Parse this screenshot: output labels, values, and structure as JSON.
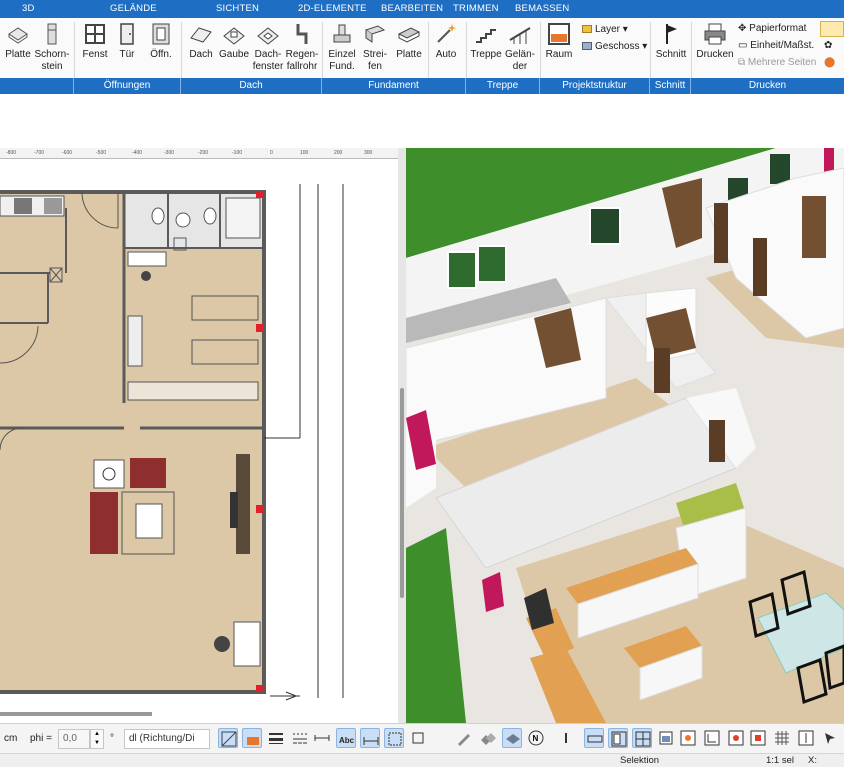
{
  "top_tabs": [
    "3D",
    "GELÄNDE",
    "SICHTEN",
    "2D-ELEMENTE",
    "BEARBEITEN",
    "TRIMMEN",
    "BEMASSEN"
  ],
  "ribbon": {
    "buttons": [
      {
        "label": "Platte",
        "icon": "slab-icon"
      },
      {
        "label": "Schorn-\nstein",
        "icon": "chimney-icon"
      },
      {
        "label": "Fenst",
        "icon": "window-icon"
      },
      {
        "label": "Tür",
        "icon": "door-icon"
      },
      {
        "label": "Öffn.",
        "icon": "opening-icon"
      },
      {
        "label": "Dach",
        "icon": "roof-icon"
      },
      {
        "label": "Gaube",
        "icon": "dormer-icon"
      },
      {
        "label": "Dach-\nfenster",
        "icon": "skylight-icon"
      },
      {
        "label": "Regen-\nfallrohr",
        "icon": "downpipe-icon"
      },
      {
        "label": "Einzel\nFund.",
        "icon": "single-foundation-icon"
      },
      {
        "label": "Strei-\nfen",
        "icon": "strip-foundation-icon"
      },
      {
        "label": "Platte",
        "icon": "foundation-slab-icon"
      },
      {
        "label": "Auto",
        "icon": "magic-wand-icon"
      },
      {
        "label": "Treppe",
        "icon": "stairs-icon"
      },
      {
        "label": "Gelän-\nder",
        "icon": "railing-icon"
      },
      {
        "label": "Raum",
        "icon": "room-icon"
      },
      {
        "label": "Schnitt",
        "icon": "section-flag-icon"
      },
      {
        "label": "Drucken",
        "icon": "printer-icon"
      }
    ],
    "layer_label": "Layer",
    "geschoss_label": "Geschoss",
    "papierformat_label": "Papierformat",
    "einheit_label": "Einheit/Maßst.",
    "mehrere_seiten_label": "Mehrere Seiten"
  },
  "groups": [
    "Öffnungen",
    "Dach",
    "Fundament",
    "Treppe",
    "Projektstruktur",
    "Schnitt",
    "Drucken"
  ],
  "ruler_ticks": [
    "-800",
    "-700",
    "-600",
    "-500",
    "-400",
    "-300",
    "-200",
    "-100",
    "0",
    "100",
    "200",
    "300"
  ],
  "bottom": {
    "unit_label": "cm",
    "phi_label": "phi =",
    "phi_value": "0,0",
    "degree_label": "°",
    "direction_value": "dl (Richtung/Di"
  },
  "status": {
    "mode": "Selektion",
    "scale": "1:1 sel",
    "x_label": "X:"
  },
  "colors": {
    "accent": "#1e6fc4",
    "floor": "#dcc8a6",
    "grass": "#3e8f2c",
    "furniture_red": "#8f2e2e",
    "cabinet_green": "#a8be48"
  }
}
